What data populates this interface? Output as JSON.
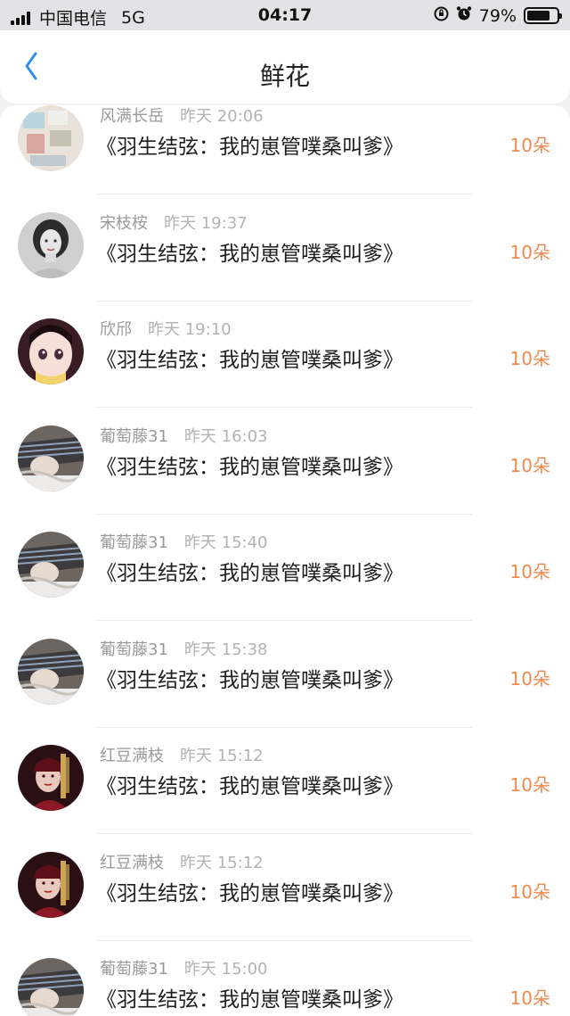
{
  "status_bar": {
    "carrier": "中国电信",
    "network": "5G",
    "time": "04:17",
    "battery": "79%",
    "battery_level": 0.79
  },
  "header": {
    "title": "鲜花"
  },
  "colors": {
    "accent": "#2f8fef",
    "count": "#ef8a4e"
  },
  "records": [
    {
      "name": "风满长岳",
      "time": "昨天 20:06",
      "book": "《羽生结弦：我的崽管噗桑叫爹》",
      "count": "10朵",
      "avatar": "photos-avatar"
    },
    {
      "name": "宋枝桉",
      "time": "昨天 19:37",
      "book": "《羽生结弦：我的崽管噗桑叫爹》",
      "count": "10朵",
      "avatar": "bw-portrait-avatar"
    },
    {
      "name": "欣邤",
      "time": "昨天 19:10",
      "book": "《羽生结弦：我的崽管噗桑叫爹》",
      "count": "10朵",
      "avatar": "anime-girl-avatar"
    },
    {
      "name": "葡萄藤31",
      "time": "昨天 16:03",
      "book": "《羽生结弦：我的崽管噗桑叫爹》",
      "count": "10朵",
      "avatar": "scarf-avatar"
    },
    {
      "name": "葡萄藤31",
      "time": "昨天 15:40",
      "book": "《羽生结弦：我的崽管噗桑叫爹》",
      "count": "10朵",
      "avatar": "scarf-avatar"
    },
    {
      "name": "葡萄藤31",
      "time": "昨天 15:38",
      "book": "《羽生结弦：我的崽管噗桑叫爹》",
      "count": "10朵",
      "avatar": "scarf-avatar"
    },
    {
      "name": "红豆满枝",
      "time": "昨天 15:12",
      "book": "《羽生结弦：我的崽管噗桑叫爹》",
      "count": "10朵",
      "avatar": "red-costume-avatar"
    },
    {
      "name": "红豆满枝",
      "time": "昨天 15:12",
      "book": "《羽生结弦：我的崽管噗桑叫爹》",
      "count": "10朵",
      "avatar": "red-costume-avatar"
    },
    {
      "name": "葡萄藤31",
      "time": "昨天 15:00",
      "book": "《羽生结弦：我的崽管噗桑叫爹》",
      "count": "10朵",
      "avatar": "scarf-avatar"
    }
  ]
}
